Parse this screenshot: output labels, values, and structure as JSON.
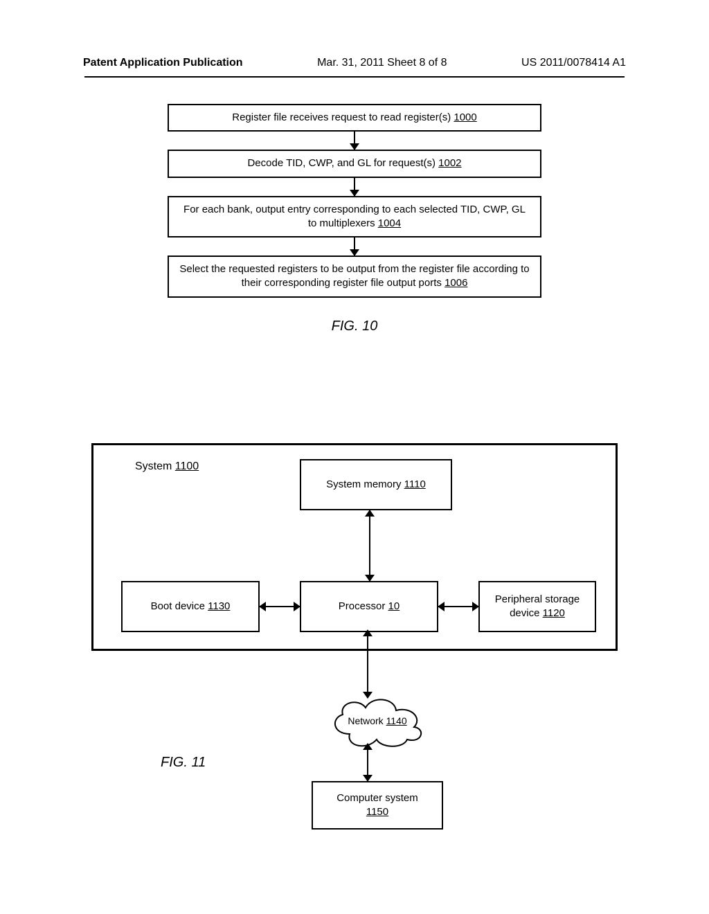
{
  "header": {
    "left": "Patent Application Publication",
    "center": "Mar. 31, 2011  Sheet 8 of 8",
    "right": "US 2011/0078414 A1"
  },
  "fig10": {
    "caption": "FIG. 10",
    "steps": [
      {
        "text": "Register file receives request to read register(s) ",
        "ref": "1000"
      },
      {
        "text": "Decode TID, CWP, and GL for request(s) ",
        "ref": "1002"
      },
      {
        "text": "For each bank, output entry corresponding to each selected TID, CWP, GL to multiplexers ",
        "ref": "1004"
      },
      {
        "text": "Select the requested registers to be output from the register file according to their corresponding register file output ports ",
        "ref": "1006"
      }
    ]
  },
  "fig11": {
    "caption": "FIG. 11",
    "system_label": "System ",
    "system_ref": "1100",
    "blocks": {
      "sysmem": {
        "label": "System memory ",
        "ref": "1110"
      },
      "boot": {
        "label": "Boot device ",
        "ref": "1130"
      },
      "proc": {
        "label": "Processor ",
        "ref": "10"
      },
      "periph": {
        "label_line1": "Peripheral storage",
        "label_line2": "device ",
        "ref": "1120"
      },
      "network": {
        "label": "Network ",
        "ref": "1140"
      },
      "compsys": {
        "label_line1": "Computer system",
        "ref": "1150"
      }
    }
  }
}
